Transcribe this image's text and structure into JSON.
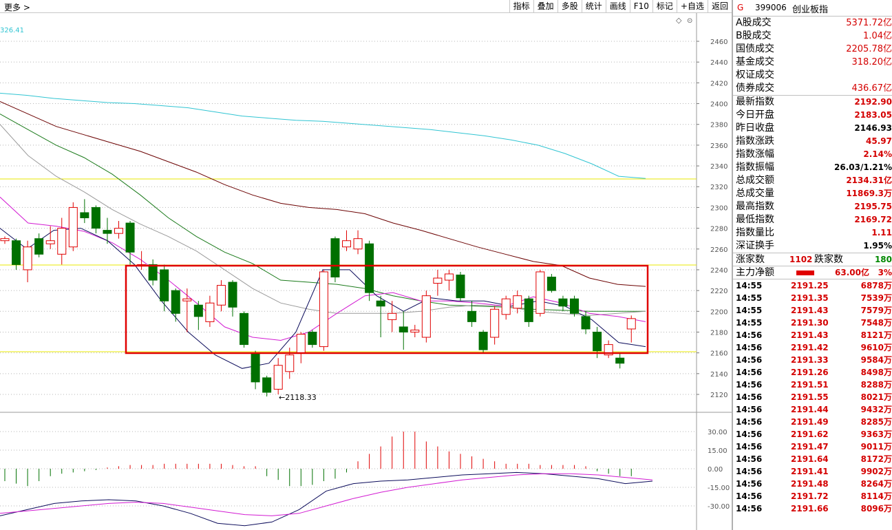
{
  "topbar": {
    "more_label": "更多 >",
    "tools": [
      "指标",
      "叠加",
      "多股",
      "统计",
      "画线",
      "F10",
      "标记",
      "+自选",
      "返回"
    ],
    "ma_value": "326.41"
  },
  "chart": {
    "price_axis_ticks": [
      "2460",
      "2440",
      "2420",
      "2400",
      "2380",
      "2360",
      "2340",
      "2320",
      "2300",
      "2280",
      "2260",
      "2240",
      "2220",
      "2200",
      "2180",
      "2160",
      "2140",
      "2120"
    ],
    "low_marker": "←2118.33",
    "indicator_axis_ticks": [
      "30.00",
      "15.00",
      "0.00",
      "-15.00",
      "-30.00"
    ],
    "colors": {
      "up": "#e00000",
      "down": "#007000",
      "ma_cyan": "#2fc4d2",
      "ma_darkred": "#6b0000",
      "ma_green": "#1a7a1a",
      "ma_gray": "#9a9a9a",
      "ma_magenta": "#d21ad2",
      "ma_navy": "#0a0a5a",
      "box": "#e00000",
      "hline": "#e8e800"
    }
  },
  "panel": {
    "code_prefix": "G",
    "code": "399006",
    "name": "创业板指",
    "turnover": [
      {
        "label": "A股成交",
        "value": "5371.72亿"
      },
      {
        "label": "B股成交",
        "value": "1.04亿"
      },
      {
        "label": "国债成交",
        "value": "2205.78亿"
      },
      {
        "label": "基金成交",
        "value": "318.20亿"
      },
      {
        "label": "权证成交",
        "value": ""
      },
      {
        "label": "债券成交",
        "value": "436.67亿"
      }
    ],
    "quote": [
      {
        "label": "最新指数",
        "value": "2192.90",
        "color": "red"
      },
      {
        "label": "今日开盘",
        "value": "2183.05",
        "color": "red"
      },
      {
        "label": "昨日收盘",
        "value": "2146.93",
        "color": "blk"
      },
      {
        "label": "指数涨跌",
        "value": "45.97",
        "color": "red"
      },
      {
        "label": "指数涨幅",
        "value": "2.14%",
        "color": "red"
      },
      {
        "label": "指数振幅",
        "value": "26.03/1.21%",
        "color": "blk"
      },
      {
        "label": "总成交额",
        "value": "2134.31亿",
        "color": "red"
      },
      {
        "label": "总成交量",
        "value": "11869.3万",
        "color": "red"
      },
      {
        "label": "最高指数",
        "value": "2195.75",
        "color": "red"
      },
      {
        "label": "最低指数",
        "value": "2169.72",
        "color": "red"
      },
      {
        "label": "指数量比",
        "value": "1.11",
        "color": "red"
      },
      {
        "label": "深证换手",
        "value": "1.95%",
        "color": "blk"
      }
    ],
    "updown": {
      "up_label": "涨家数",
      "up": "1102",
      "down_label": "跌家数",
      "down": "180"
    },
    "flow": {
      "label": "主力净额",
      "value": "63.00亿",
      "pct": "3%"
    },
    "ticks": [
      {
        "time": "14:55",
        "price": "2191.25",
        "vol": "6878万"
      },
      {
        "time": "14:55",
        "price": "2191.35",
        "vol": "7539万"
      },
      {
        "time": "14:55",
        "price": "2191.43",
        "vol": "7579万"
      },
      {
        "time": "14:55",
        "price": "2191.30",
        "vol": "7548万"
      },
      {
        "time": "14:56",
        "price": "2191.43",
        "vol": "8121万"
      },
      {
        "time": "14:56",
        "price": "2191.42",
        "vol": "9610万"
      },
      {
        "time": "14:56",
        "price": "2191.33",
        "vol": "9584万"
      },
      {
        "time": "14:56",
        "price": "2191.26",
        "vol": "8498万"
      },
      {
        "time": "14:56",
        "price": "2191.51",
        "vol": "8288万"
      },
      {
        "time": "14:56",
        "price": "2191.55",
        "vol": "8021万"
      },
      {
        "time": "14:56",
        "price": "2191.44",
        "vol": "9432万"
      },
      {
        "time": "14:56",
        "price": "2191.49",
        "vol": "8285万"
      },
      {
        "time": "14:56",
        "price": "2191.62",
        "vol": "9363万"
      },
      {
        "time": "14:56",
        "price": "2191.47",
        "vol": "9011万"
      },
      {
        "time": "14:56",
        "price": "2191.64",
        "vol": "8172万"
      },
      {
        "time": "14:56",
        "price": "2191.41",
        "vol": "9902万"
      },
      {
        "time": "14:56",
        "price": "2191.48",
        "vol": "8264万"
      },
      {
        "time": "14:56",
        "price": "2191.72",
        "vol": "8114万"
      },
      {
        "time": "14:56",
        "price": "2191.66",
        "vol": "8096万"
      }
    ]
  }
}
